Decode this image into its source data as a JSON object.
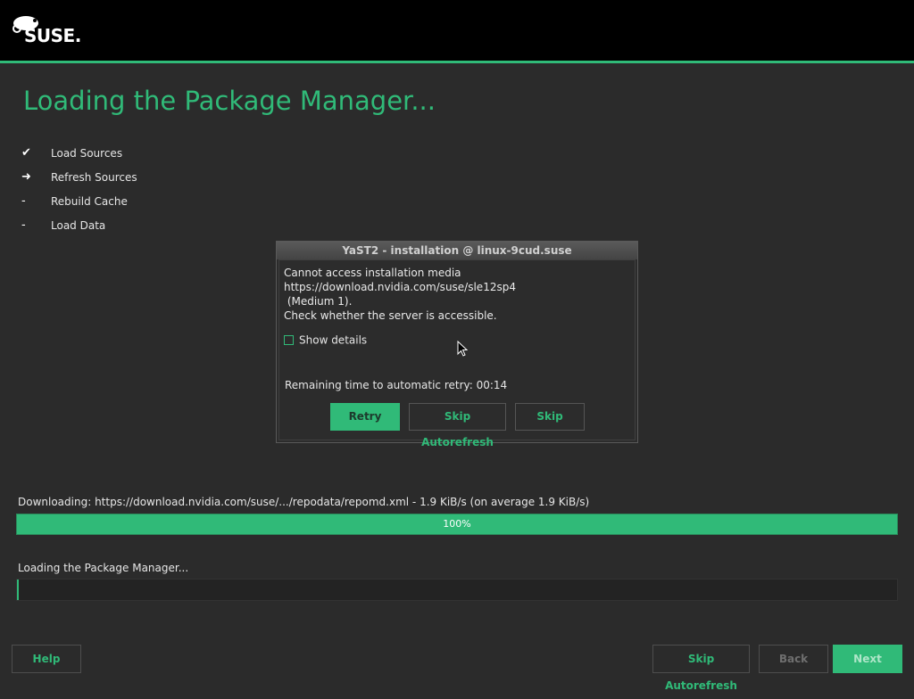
{
  "header": {
    "logo_text": "SUSE."
  },
  "page": {
    "title": "Loading the Package Manager..."
  },
  "steps": [
    {
      "marker": "✔",
      "label": "Load Sources"
    },
    {
      "marker": "➜",
      "label": "Refresh Sources"
    },
    {
      "marker": "-",
      "label": "Rebuild Cache"
    },
    {
      "marker": "-",
      "label": "Load Data"
    }
  ],
  "dialog": {
    "title": "YaST2 - installation @ linux-9cud.suse",
    "message_lines": [
      "Cannot access installation media",
      "https://download.nvidia.com/suse/sle12sp4",
      " (Medium 1).",
      "Check whether the server is accessible."
    ],
    "show_details_label": "Show details",
    "show_details_checked": false,
    "retry_countdown": "Remaining time to automatic retry: 00:14",
    "buttons": {
      "retry": "Retry",
      "skip_autorefresh": "Skip Autorefresh",
      "skip": "Skip"
    }
  },
  "progress": {
    "download_label": "Downloading: https://download.nvidia.com/suse/.../repodata/repomd.xml - 1.9 KiB/s (on average 1.9 KiB/s)",
    "download_percent": 100,
    "download_text": "100%",
    "loading_label": "Loading the Package Manager...",
    "loading_percent": 0
  },
  "footer": {
    "help": "Help",
    "skip_autorefresh": "Skip Autorefresh",
    "back": "Back",
    "next": "Next"
  },
  "colors": {
    "accent": "#30ba78",
    "background": "#2b2b2b",
    "topbar": "#000000"
  }
}
